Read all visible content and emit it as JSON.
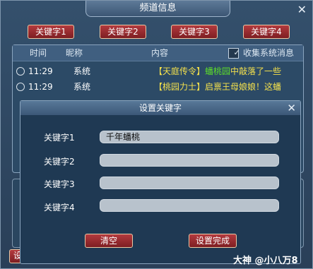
{
  "window": {
    "title": "频道信息"
  },
  "keyword_tabs": [
    "关键字1",
    "关键字2",
    "关键字3",
    "关键字4"
  ],
  "list": {
    "headers": {
      "time": "时间",
      "nickname": "昵称",
      "content": "内容",
      "collect": "收集系统消息"
    },
    "collect_checked": true,
    "rows": [
      {
        "time": "11:29",
        "nickname": "系统",
        "content_prefix": "【天庭传令】",
        "content_highlight": "蟠桃园",
        "content_suffix": "中敲落了一些"
      },
      {
        "time": "11:29",
        "nickname": "系统",
        "content_prefix": "【桃园力士】",
        "content_highlight": "",
        "content_suffix": "启禀王母娘娘！这蟠"
      }
    ]
  },
  "bottom_left_button": "设",
  "dialog": {
    "title": "设置关键字",
    "labels": [
      "关键字1",
      "关键字2",
      "关键字3",
      "关键字4"
    ],
    "values": [
      "千年蟠桃",
      "",
      "",
      ""
    ],
    "clear_button": "清空",
    "done_button": "设置完成"
  },
  "watermark": "大神 @小八万8",
  "icons": {
    "close": "close-icon",
    "checkbox": "checkmark-icon",
    "radio": "radio-icon"
  }
}
